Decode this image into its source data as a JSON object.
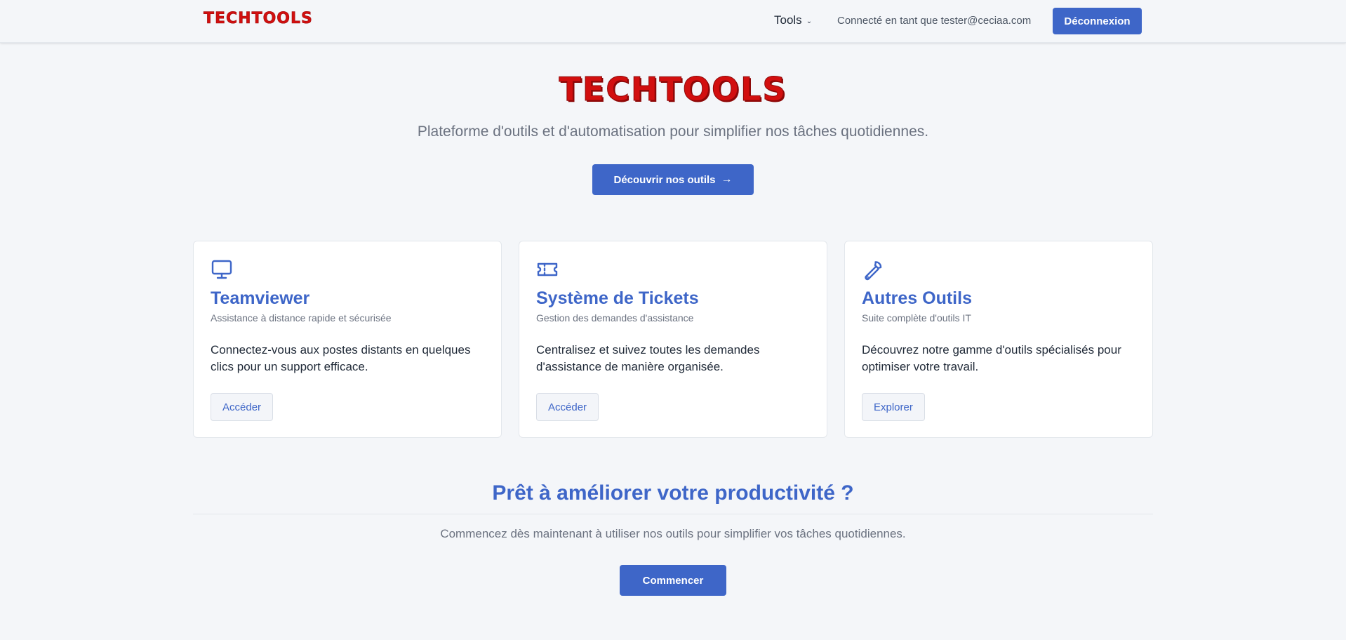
{
  "navbar": {
    "logo": "TECHTOOLS",
    "tools_label": "Tools",
    "user_text": "Connecté en tant que tester@ceciaa.com",
    "logout_label": "Déconnexion"
  },
  "hero": {
    "logo": "TECHTOOLS",
    "subtitle": "Plateforme d'outils et d'automatisation pour simplifier nos tâches quotidiennes.",
    "cta_label": "Découvrir nos outils"
  },
  "cards": [
    {
      "icon": "monitor-icon",
      "title": "Teamviewer",
      "subtitle": "Assistance à distance rapide et sécurisée",
      "description": "Connectez-vous aux postes distants en quelques clics pour un support efficace.",
      "button": "Accéder"
    },
    {
      "icon": "ticket-icon",
      "title": "Système de Tickets",
      "subtitle": "Gestion des demandes d'assistance",
      "description": "Centralisez et suivez toutes les demandes d'assistance de manière organisée.",
      "button": "Accéder"
    },
    {
      "icon": "wrench-icon",
      "title": "Autres Outils",
      "subtitle": "Suite complète d'outils IT",
      "description": "Découvrez notre gamme d'outils spécialisés pour optimiser votre travail.",
      "button": "Explorer"
    }
  ],
  "bottom": {
    "title": "Prêt à améliorer votre productivité ?",
    "text": "Commencez dès maintenant à utiliser nos outils pour simplifier vos tâches quotidiennes.",
    "cta_label": "Commencer"
  },
  "colors": {
    "primary": "#3e66c8",
    "logo_red": "#d20f0f",
    "background": "#f4f6f9"
  }
}
